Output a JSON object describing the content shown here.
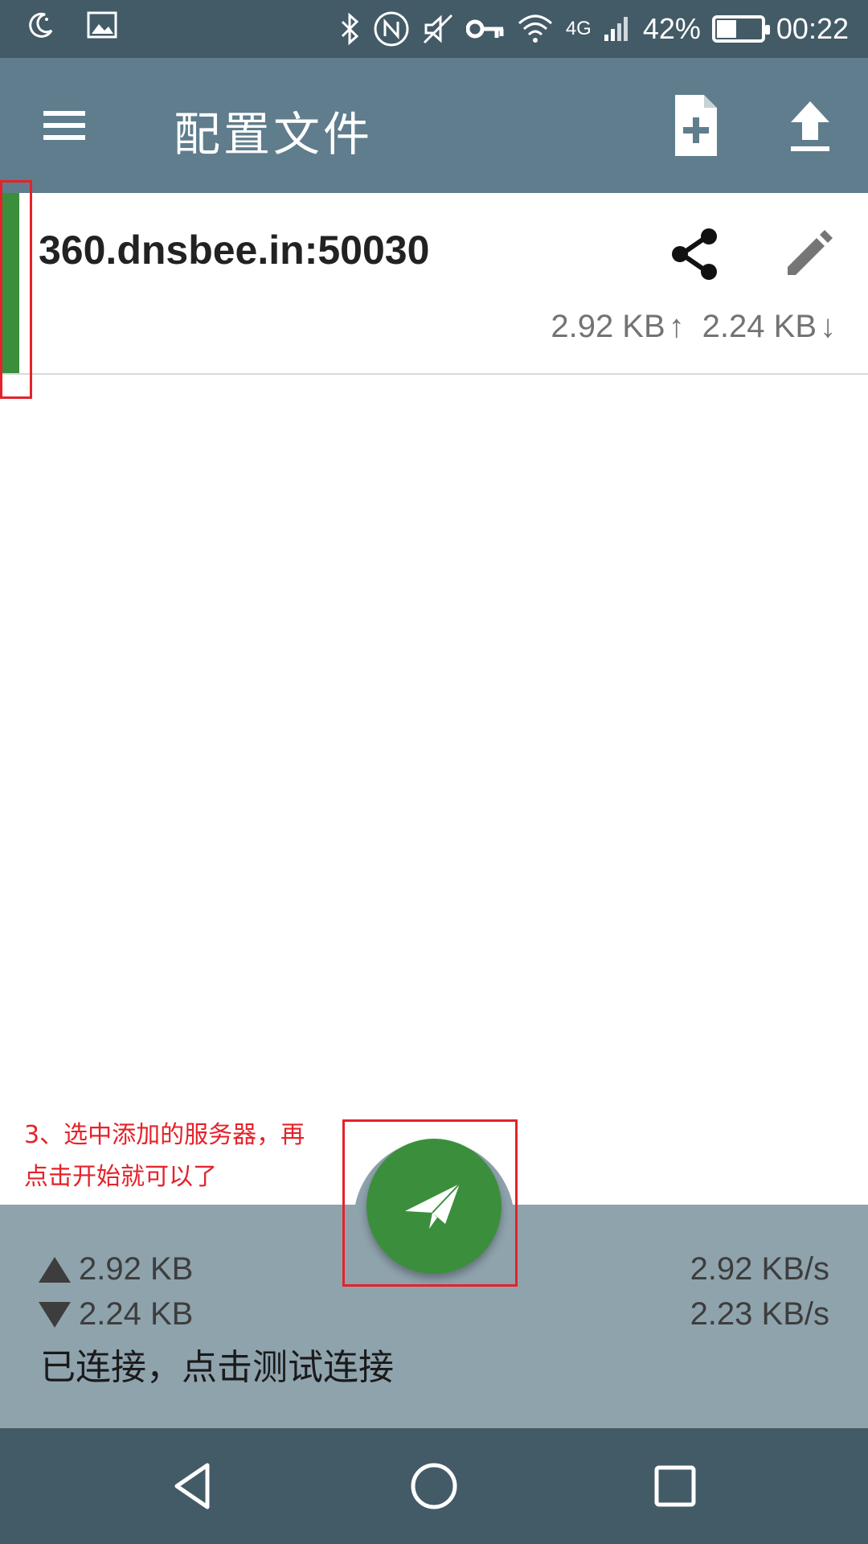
{
  "status_bar": {
    "battery_percent": "42%",
    "battery_level": 0.42,
    "network": "4G",
    "time": "00:22",
    "icons": [
      "moon-icon",
      "image-icon",
      "bluetooth-icon",
      "nfc-icon",
      "mute-icon",
      "vpn-key-icon",
      "wifi-icon",
      "signal-icon",
      "battery-icon"
    ]
  },
  "app_bar": {
    "title": "配置文件",
    "menu_icon": "hamburger-menu-icon",
    "add_icon": "add-file-icon",
    "upload_icon": "upload-icon"
  },
  "profiles": [
    {
      "name": "360.dnsbee.in:50030",
      "upload": "2.92 KB",
      "upload_arrow": "↑",
      "download": "2.24 KB",
      "download_arrow": "↓",
      "selected": true
    }
  ],
  "annotation": {
    "text_line1": "3、选中添加的服务器，再",
    "text_line2": "点击开始就可以了"
  },
  "stats": {
    "upload_total": "2.92 KB",
    "download_total": "2.24 KB",
    "upload_rate": "2.92 KB/s",
    "download_rate": "2.23 KB/s",
    "status_message": "已连接，点击测试连接"
  },
  "colors": {
    "status_bar": "#435a67",
    "app_bar": "#5f7d8c",
    "accent_green": "#3b8f3c",
    "stats_panel": "#8fa3ad",
    "annotation_red": "#e5222a"
  }
}
